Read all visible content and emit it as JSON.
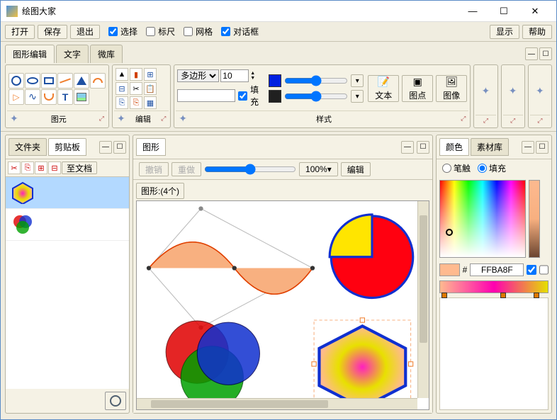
{
  "window": {
    "title": "绘图大家"
  },
  "toolbar": {
    "open": "打开",
    "save": "保存",
    "exit": "退出",
    "select": "选择",
    "ruler": "标尺",
    "grid": "网格",
    "dialog": "对话框",
    "show": "显示",
    "help": "帮助",
    "select_checked": true,
    "ruler_checked": false,
    "grid_checked": false,
    "dialog_checked": true
  },
  "ribbon": {
    "tabs": {
      "shape_edit": "图形编辑",
      "text": "文字",
      "micro": "微库"
    },
    "panels": {
      "primitives": "图元",
      "edit": "编辑",
      "style": "样式",
      "polygon_label": "多边形",
      "polygon_sides": "10",
      "fill_label": "填充",
      "fill_checked": true,
      "text_btn": "文本",
      "point_btn": "图点",
      "image_btn": "图像"
    }
  },
  "left_panel": {
    "tab_folder": "文件夹",
    "tab_clipboard": "剪贴板",
    "to_doc": "至文档"
  },
  "canvas": {
    "title": "图形",
    "undo": "撤销",
    "redo": "重做",
    "zoom": "100%",
    "edit": "编辑",
    "label": "图形:(4个)"
  },
  "color_panel": {
    "tab_color": "颜色",
    "tab_material": "素材库",
    "stroke": "笔触",
    "fill": "填充",
    "fill_selected": true,
    "hex": "FFBA8F",
    "hex_prefix": "#"
  }
}
